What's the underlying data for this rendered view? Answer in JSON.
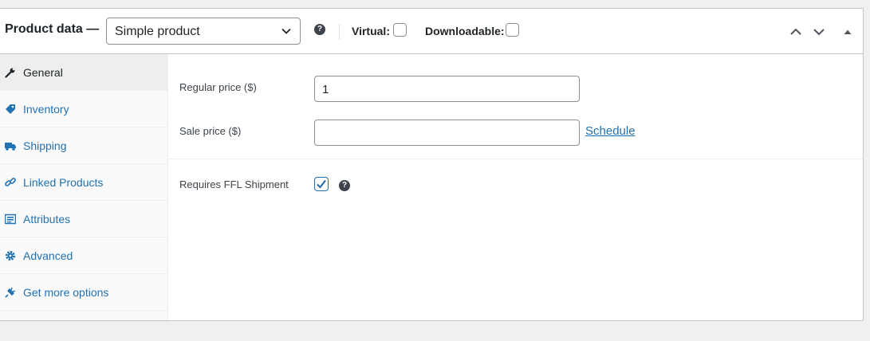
{
  "header": {
    "title": "Product data —",
    "product_type": "Simple product",
    "virtual_label": "Virtual:",
    "virtual_checked": false,
    "downloadable_label": "Downloadable:",
    "downloadable_checked": false
  },
  "tabs": [
    {
      "label": "General",
      "icon": "wrench-icon",
      "active": true
    },
    {
      "label": "Inventory",
      "icon": "tag-icon",
      "active": false
    },
    {
      "label": "Shipping",
      "icon": "truck-icon",
      "active": false
    },
    {
      "label": "Linked Products",
      "icon": "link-icon",
      "active": false
    },
    {
      "label": "Attributes",
      "icon": "list-icon",
      "active": false
    },
    {
      "label": "Advanced",
      "icon": "gear-icon",
      "active": false
    },
    {
      "label": "Get more options",
      "icon": "plugin-icon",
      "active": false
    }
  ],
  "general": {
    "regular_price_label": "Regular price ($)",
    "regular_price_value": "1",
    "sale_price_label": "Sale price ($)",
    "sale_price_value": "",
    "schedule_link": "Schedule",
    "ffl_label": "Requires FFL Shipment",
    "ffl_checked": true
  },
  "colors": {
    "accent": "#2271b1",
    "text": "#1d2327",
    "border": "#c3c4c7",
    "tab_bg": "#fafafa",
    "tab_active_bg": "#eeeeee"
  }
}
